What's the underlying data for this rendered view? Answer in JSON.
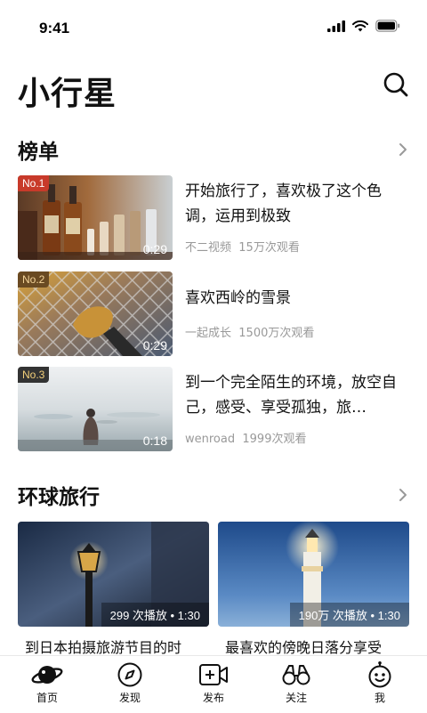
{
  "status": {
    "time": "9:41"
  },
  "header": {
    "title": "小行星"
  },
  "ranking": {
    "title": "榜单",
    "items": [
      {
        "rank": "No.1",
        "duration": "0:29",
        "title": "开始旅行了，喜欢极了这个色调，运用到极致",
        "author": "不二视频",
        "views": "15万次观看"
      },
      {
        "rank": "No.2",
        "duration": "0:29",
        "title": "喜欢西岭的雪景",
        "author": "一起成长",
        "views": "1500万次观看"
      },
      {
        "rank": "No.3",
        "duration": "0:18",
        "title": "到一个完全陌生的环境，放空自己，感受、享受孤独，旅…",
        "author": "wenroad",
        "views": "1999次观看"
      }
    ]
  },
  "global_travel": {
    "title": "环球旅行",
    "cards": [
      {
        "stat": "299 次播放 • 1:30",
        "title": "到日本拍摄旅游节目的时"
      },
      {
        "stat": "190万 次播放 • 1:30",
        "title": "最喜欢的傍晚日落分享受"
      }
    ]
  },
  "tabbar": {
    "items": [
      {
        "label": "首页",
        "icon": "planet-icon"
      },
      {
        "label": "发现",
        "icon": "compass-icon"
      },
      {
        "label": "发布",
        "icon": "video-add-icon"
      },
      {
        "label": "关注",
        "icon": "binoculars-icon"
      },
      {
        "label": "我",
        "icon": "robot-face-icon"
      }
    ]
  }
}
